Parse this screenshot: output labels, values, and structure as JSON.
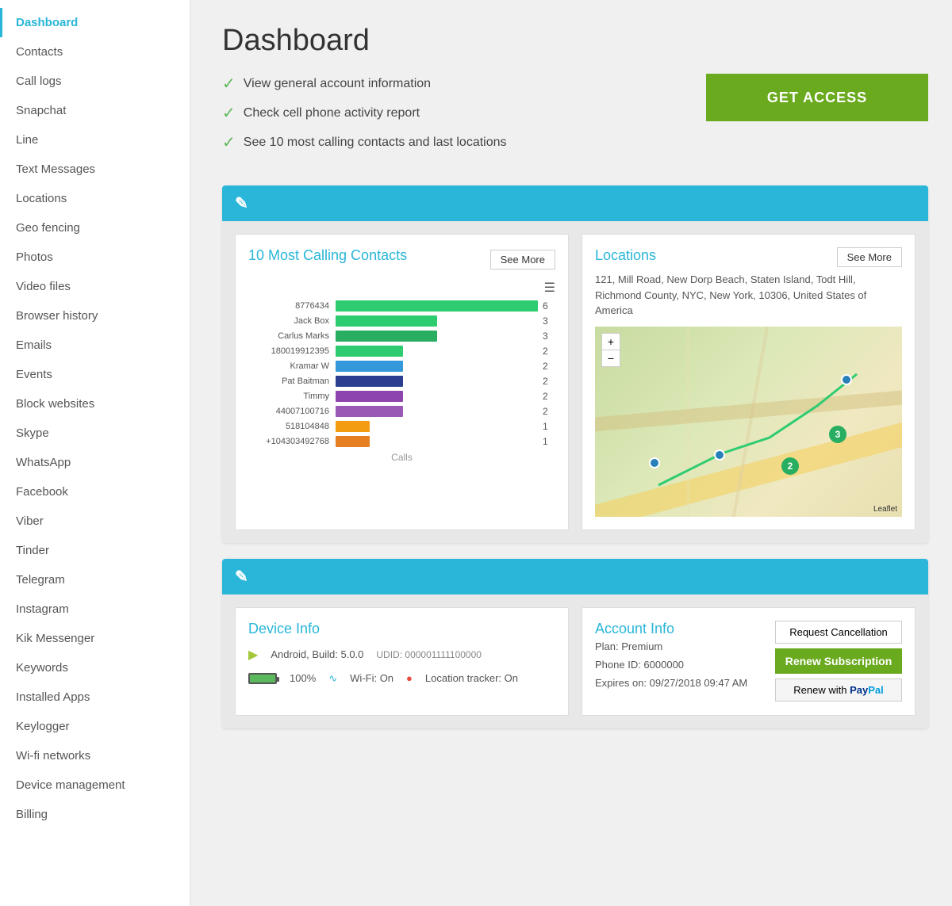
{
  "sidebar": {
    "items": [
      {
        "label": "Dashboard",
        "active": true
      },
      {
        "label": "Contacts",
        "active": false
      },
      {
        "label": "Call logs",
        "active": false
      },
      {
        "label": "Snapchat",
        "active": false
      },
      {
        "label": "Line",
        "active": false
      },
      {
        "label": "Text Messages",
        "active": false
      },
      {
        "label": "Locations",
        "active": false
      },
      {
        "label": "Geo fencing",
        "active": false
      },
      {
        "label": "Photos",
        "active": false
      },
      {
        "label": "Video files",
        "active": false
      },
      {
        "label": "Browser history",
        "active": false
      },
      {
        "label": "Emails",
        "active": false
      },
      {
        "label": "Events",
        "active": false
      },
      {
        "label": "Block websites",
        "active": false
      },
      {
        "label": "Skype",
        "active": false
      },
      {
        "label": "WhatsApp",
        "active": false
      },
      {
        "label": "Facebook",
        "active": false
      },
      {
        "label": "Viber",
        "active": false
      },
      {
        "label": "Tinder",
        "active": false
      },
      {
        "label": "Telegram",
        "active": false
      },
      {
        "label": "Instagram",
        "active": false
      },
      {
        "label": "Kik Messenger",
        "active": false
      },
      {
        "label": "Keywords",
        "active": false
      },
      {
        "label": "Installed Apps",
        "active": false
      },
      {
        "label": "Keylogger",
        "active": false
      },
      {
        "label": "Wi-fi networks",
        "active": false
      },
      {
        "label": "Device management",
        "active": false
      },
      {
        "label": "Billing",
        "active": false
      }
    ]
  },
  "main": {
    "title": "Dashboard",
    "features": [
      {
        "text": "View general account information"
      },
      {
        "text": "Check cell phone activity report"
      },
      {
        "text": "See 10 most calling contacts and last locations"
      }
    ],
    "get_access_label": "GET ACCESS",
    "panel1": {
      "contacts_title": "10 Most Calling Contacts",
      "see_more_label": "See More",
      "chart_data": [
        {
          "name": "8776434",
          "value": 6,
          "max": 6,
          "color": "#2ecc71"
        },
        {
          "name": "Jack Box",
          "value": 3,
          "max": 6,
          "color": "#2ecc71"
        },
        {
          "name": "Carlus Marks",
          "value": 3,
          "max": 6,
          "color": "#27ae60"
        },
        {
          "name": "180019912395",
          "value": 2,
          "max": 6,
          "color": "#2ecc71"
        },
        {
          "name": "Kramar W",
          "value": 2,
          "max": 6,
          "color": "#3498db"
        },
        {
          "name": "Pat Baitman",
          "value": 2,
          "max": 6,
          "color": "#2c3e90"
        },
        {
          "name": "Timmy",
          "value": 2,
          "max": 6,
          "color": "#8e44ad"
        },
        {
          "name": "44007100716",
          "value": 2,
          "max": 6,
          "color": "#9b59b6"
        },
        {
          "name": "518104848",
          "value": 1,
          "max": 6,
          "color": "#f39c12"
        },
        {
          "name": "+104303492768",
          "value": 1,
          "max": 6,
          "color": "#e67e22"
        }
      ],
      "chart_x_label": "Calls",
      "locations_title": "Locations",
      "locations_address": "121, Mill Road, New Dorp Beach,\nStaten Island, Todt Hill, Richmond\nCounty, NYC, New York, 10306,\nUnited States of America",
      "locations_see_more": "See More",
      "map_zoom_plus": "+",
      "map_zoom_minus": "−",
      "map_leaflet": "Leaflet"
    },
    "panel2": {
      "device_info_title": "Device Info",
      "android_label": "Android, Build: 5.0.0",
      "udid_label": "UDID: 000001111100000",
      "battery_label": "100%",
      "wifi_label": "Wi-Fi: On",
      "location_tracker_label": "Location tracker: On",
      "account_info_title": "Account Info",
      "plan_label": "Plan: Premium",
      "phone_id_label": "Phone ID: 6000000",
      "expires_label": "Expires on: 09/27/2018 09:47 AM",
      "request_cancel_label": "Request Cancellation",
      "renew_label": "Renew Subscription",
      "paypal_label": "Renew with",
      "paypal_brand": "PayPal"
    }
  }
}
